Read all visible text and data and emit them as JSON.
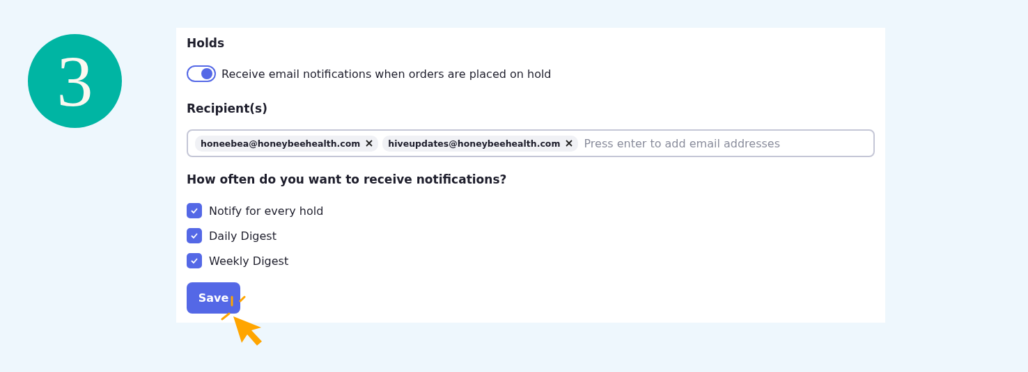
{
  "step_badge": "3",
  "section_title": "Holds",
  "toggle": {
    "label": "Receive email notifications when orders are placed on hold",
    "on": true
  },
  "recipients": {
    "title": "Recipient(s)",
    "chips": [
      "honeebea@honeybeehealth.com",
      "hiveupdates@honeybeehealth.com"
    ],
    "placeholder": "Press enter to add email addresses"
  },
  "frequency": {
    "title": "How often do you want to receive notifications?",
    "options": [
      {
        "label": "Notify for every hold",
        "checked": true
      },
      {
        "label": "Daily Digest",
        "checked": true
      },
      {
        "label": "Weekly Digest",
        "checked": true
      }
    ]
  },
  "save_button": "Save"
}
